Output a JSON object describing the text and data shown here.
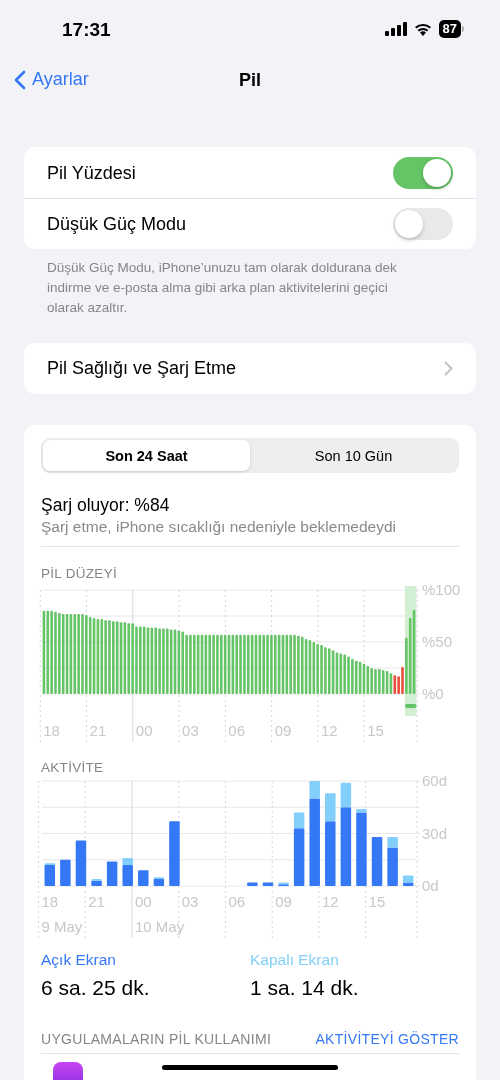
{
  "status_bar": {
    "time": "17:31",
    "battery": "87"
  },
  "nav": {
    "back": "Ayarlar",
    "title": "Pil"
  },
  "settings": {
    "rows": [
      {
        "label": "Pil Yüzdesi",
        "on": true
      },
      {
        "label": "Düşük Güç Modu",
        "on": false
      }
    ],
    "footer": "Düşük Güç Modu, iPhone’unuzu tam olarak doldurana dek indirme ve e-posta alma gibi arka plan aktivitelerini geçici olarak azaltır."
  },
  "health": {
    "label": "Pil Sağlığı ve Şarj Etme"
  },
  "usage": {
    "segments": [
      {
        "label": "Son 24 Saat",
        "selected": true
      },
      {
        "label": "Son 10 Gün",
        "selected": false
      }
    ],
    "charge_title": "Şarj oluyor: %84",
    "charge_note": "Şarj etme, iPhone sıcaklığı nedeniyle beklemedeydi",
    "level_label": "PİL DÜZEYİ",
    "level_chart": {
      "chart_data": {
        "type": "bar",
        "ylim": [
          0,
          100
        ],
        "yticks": [
          {
            "value": 0,
            "label": "%0"
          },
          {
            "value": 50,
            "label": "%50"
          },
          {
            "value": 100,
            "label": "%100"
          }
        ],
        "categories": [
          null,
          null,
          "18",
          null,
          null,
          null,
          null,
          null,
          null,
          null,
          null,
          null,
          null,
          null,
          "21",
          null,
          null,
          null,
          null,
          null,
          null,
          null,
          null,
          null,
          null,
          null,
          "00",
          null,
          null,
          null,
          null,
          null,
          null,
          null,
          null,
          null,
          null,
          null,
          "03",
          null,
          null,
          null,
          null,
          null,
          null,
          null,
          null,
          null,
          null,
          null,
          "06",
          null,
          null,
          null,
          null,
          null,
          null,
          null,
          null,
          null,
          null,
          null,
          "09",
          null,
          null,
          null,
          null,
          null,
          null,
          null,
          null,
          null,
          null,
          null,
          "12",
          null,
          null,
          null,
          null,
          null,
          null,
          null,
          null,
          null,
          null,
          null,
          "15",
          null,
          null,
          null,
          null,
          null,
          null,
          null,
          null,
          null,
          null
        ],
        "series": [
          {
            "color": "#65c466",
            "values": [
              80,
              80,
              80,
              79,
              78,
              77,
              77,
              77,
              77,
              77,
              77,
              76,
              74,
              73,
              72,
              72,
              71,
              71,
              70,
              70,
              69,
              69,
              68,
              68,
              65,
              65,
              65,
              64,
              64,
              64,
              63,
              63,
              63,
              62,
              62,
              61,
              60,
              57,
              57,
              57,
              57,
              57,
              57,
              57,
              57,
              57,
              57,
              57,
              57,
              57,
              57,
              57,
              57,
              57,
              57,
              57,
              57,
              57,
              57,
              57,
              57,
              57,
              57,
              57,
              57,
              57,
              56,
              55,
              53,
              52,
              50,
              48,
              47,
              45,
              44,
              42,
              40,
              39,
              38,
              36,
              34,
              32,
              31,
              29,
              27,
              25,
              24,
              24,
              23,
              22,
              20,
              null,
              null,
              null,
              54,
              73,
              81
            ]
          },
          {
            "color": "#eb4e3d",
            "values": [
              null,
              null,
              null,
              null,
              null,
              null,
              null,
              null,
              null,
              null,
              null,
              null,
              null,
              null,
              null,
              null,
              null,
              null,
              null,
              null,
              null,
              null,
              null,
              null,
              null,
              null,
              null,
              null,
              null,
              null,
              null,
              null,
              null,
              null,
              null,
              null,
              null,
              null,
              null,
              null,
              null,
              null,
              null,
              null,
              null,
              null,
              null,
              null,
              null,
              null,
              null,
              null,
              null,
              null,
              null,
              null,
              null,
              null,
              null,
              null,
              null,
              null,
              null,
              null,
              null,
              null,
              null,
              null,
              null,
              null,
              null,
              null,
              null,
              null,
              null,
              null,
              null,
              null,
              null,
              null,
              null,
              null,
              null,
              null,
              null,
              null,
              null,
              null,
              null,
              null,
              null,
              18,
              17,
              26,
              null,
              null,
              null
            ]
          }
        ]
      }
    },
    "activity_label": "AKTİVİTE",
    "activity_chart": {
      "chart_data": {
        "type": "bar",
        "stacked": true,
        "ylim": [
          0,
          60
        ],
        "yticks": [
          {
            "value": 0,
            "label": "0d"
          },
          {
            "value": 30,
            "label": "30d"
          },
          {
            "value": 60,
            "label": "60d"
          }
        ],
        "categories": [
          "18",
          null,
          null,
          "21",
          null,
          null,
          "00",
          null,
          null,
          "03",
          null,
          null,
          "06",
          null,
          null,
          "09",
          null,
          null,
          "12",
          null,
          null,
          "15",
          null,
          null
        ],
        "series": [
          {
            "name": "Açık Ekran",
            "color": "#3478f6",
            "values": [
              12,
              15,
              26,
              3,
              14,
              12,
              9,
              4,
              37,
              0,
              0,
              0,
              0,
              2,
              2,
              1,
              33,
              50,
              37,
              45,
              42,
              28,
              22,
              2
            ]
          },
          {
            "name": "Kapalı Ekran",
            "color": "#81cffa",
            "values": [
              1,
              0,
              0,
              1,
              0,
              4,
              0,
              1,
              0,
              0,
              0,
              0,
              0,
              0,
              0,
              1,
              9,
              10,
              16,
              14,
              2,
              0,
              6,
              4
            ]
          }
        ],
        "annotations": [
          "9 May",
          "10 May"
        ]
      }
    },
    "summary": [
      {
        "value": "6 sa. 25 dk."
      },
      {
        "value": "1 sa. 14 dk."
      }
    ],
    "apps_header": "UYGULAMALARIN PİL KULLANIMI",
    "apps_action": "AKTİVİTEYİ GÖSTER"
  }
}
